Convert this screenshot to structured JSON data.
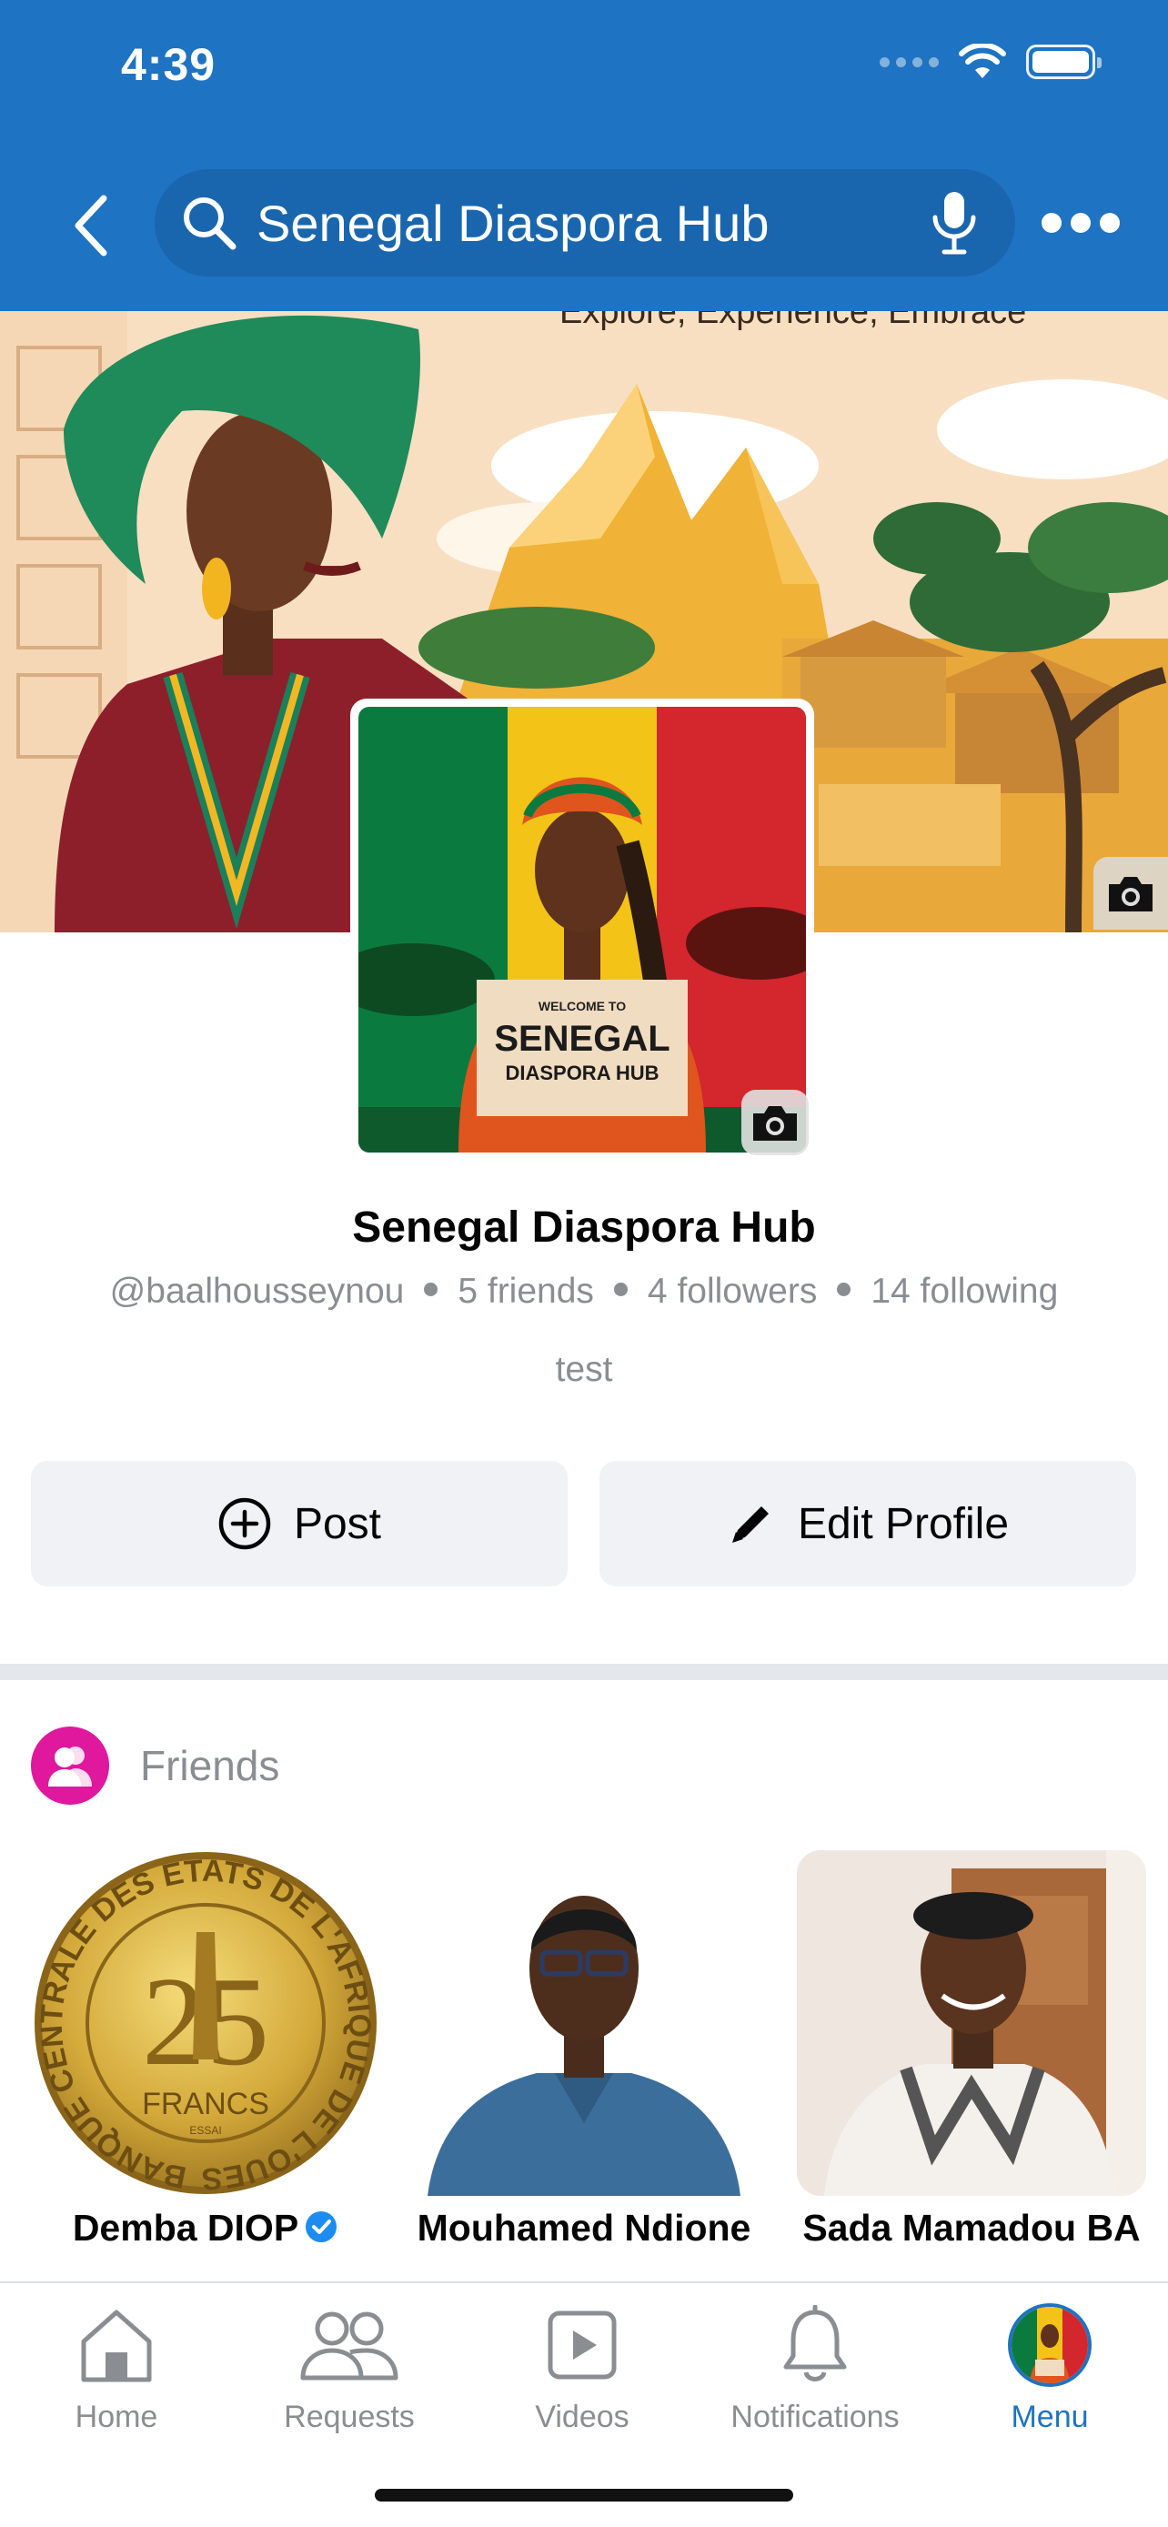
{
  "status_bar": {
    "time": "4:39"
  },
  "header": {
    "search_value": "Senegal Diaspora Hub",
    "icons": [
      "back-chevron-icon",
      "search-icon",
      "microphone-icon",
      "more-dots-icon"
    ]
  },
  "cover": {
    "tagline": "Explore, Experience, Embrace"
  },
  "avatar": {
    "sign_line1": "WELCOME TO",
    "sign_line2": "SENEGAL",
    "sign_line3": "DIASPORA HUB"
  },
  "profile": {
    "name": "Senegal Diaspora Hub",
    "handle": "@baalhousseynou",
    "friends": "5 friends",
    "followers": "4 followers",
    "following": "14 following",
    "bio": "test"
  },
  "actions": {
    "post_label": "Post",
    "edit_label": "Edit Profile"
  },
  "friends_section": {
    "title": "Friends",
    "items": [
      {
        "name": "Demba DIOP",
        "verified": true
      },
      {
        "name": "Mouhamed Ndione",
        "verified": false
      },
      {
        "name": "Sada Mamadou BA",
        "verified": false
      }
    ]
  },
  "coin": {
    "ring_text": "BANQUE CENTRALE DES ETATS DE L'AFRIQUE DE L'OUEST",
    "value": "25",
    "unit": "FRANCS",
    "small": "ESSAI"
  },
  "tabs": [
    {
      "label": "Home",
      "icon": "home-icon"
    },
    {
      "label": "Requests",
      "icon": "people-icon"
    },
    {
      "label": "Videos",
      "icon": "video-play-icon"
    },
    {
      "label": "Notifications",
      "icon": "bell-icon"
    },
    {
      "label": "Menu",
      "icon": "profile-avatar"
    }
  ],
  "colors": {
    "brand_blue": "#1e73c2",
    "friends_pink": "#e0189d",
    "muted_text": "#8a8d91",
    "button_bg": "#f0f2f5",
    "senegal_green": "#0b7a3e",
    "senegal_yellow": "#f3c318",
    "senegal_red": "#d3262d"
  }
}
